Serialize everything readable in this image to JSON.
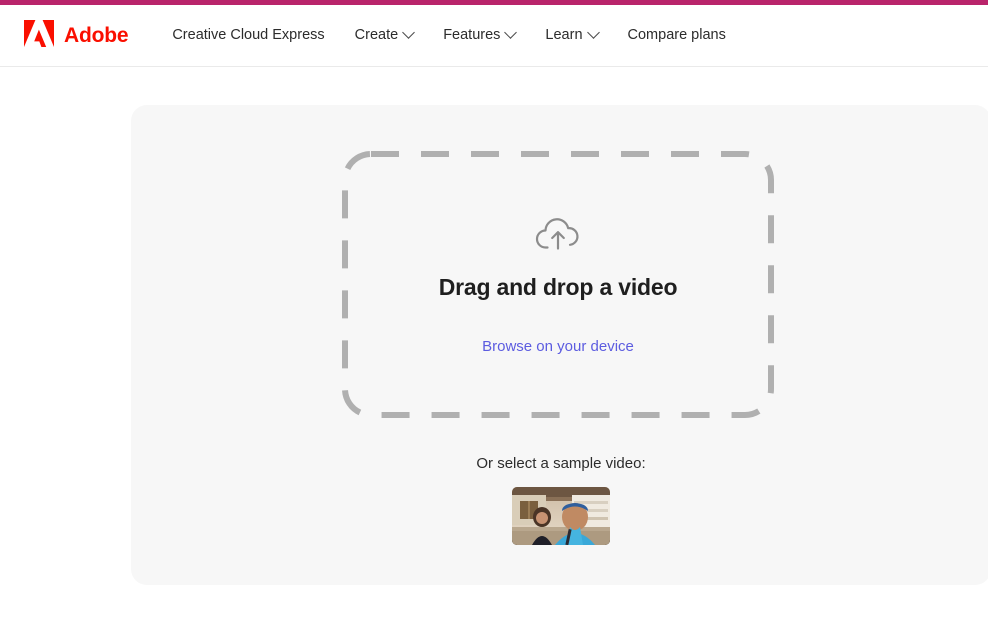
{
  "theme": {
    "accent_bar_color": "#b9246b",
    "brand_color": "#fa0f00",
    "link_color": "#5c5ce0",
    "card_background": "#f7f7f7",
    "dashed_border_color": "#b0b0b0"
  },
  "header": {
    "brand": {
      "logo_icon": "adobe-logo-icon",
      "wordmark": "Adobe"
    },
    "nav": [
      {
        "label": "Creative Cloud Express",
        "has_dropdown": false
      },
      {
        "label": "Create",
        "has_dropdown": true,
        "icon": "chevron-down-icon"
      },
      {
        "label": "Features",
        "has_dropdown": true,
        "icon": "chevron-down-icon"
      },
      {
        "label": "Learn",
        "has_dropdown": true,
        "icon": "chevron-down-icon"
      },
      {
        "label": "Compare plans",
        "has_dropdown": false
      }
    ]
  },
  "main": {
    "dropzone": {
      "icon": "cloud-upload-icon",
      "title": "Drag and drop a video",
      "browse_link": "Browse on your device"
    },
    "sample": {
      "label": "Or select a sample video:",
      "thumbnail_name": "sample-video-thumbnail"
    }
  }
}
